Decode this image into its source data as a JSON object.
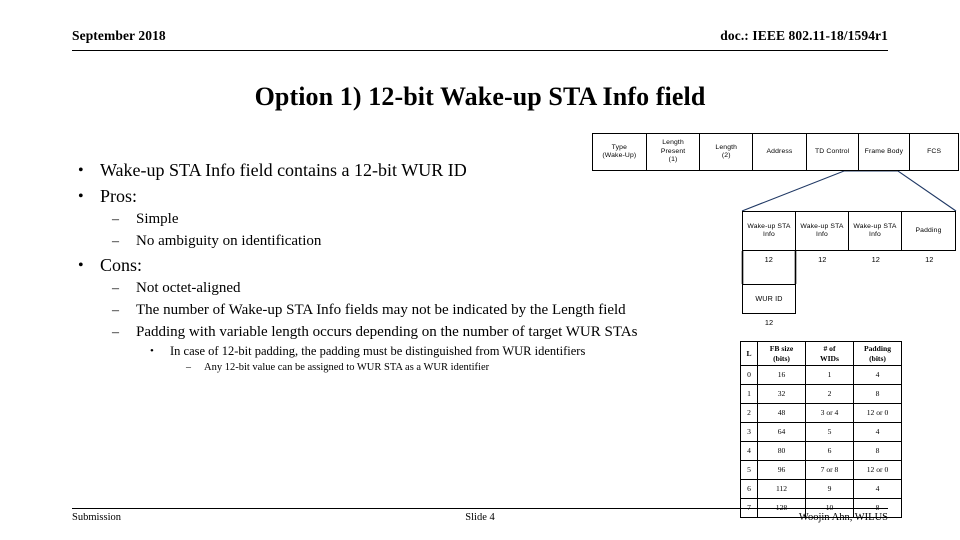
{
  "header": {
    "date": "September 2018",
    "doc": "doc.: IEEE 802.11-18/1594r1"
  },
  "title": "Option 1) 12-bit Wake-up STA Info field",
  "bullets": {
    "b1": "Wake-up STA Info field contains a 12-bit WUR ID",
    "b2": "Pros:",
    "b2a": "Simple",
    "b2b": "No ambiguity on identification",
    "b3": "Cons:",
    "b3a": "Not octet-aligned",
    "b3b": "The number of Wake-up STA Info fields may not be indicated by the Length field",
    "b3c": "Padding with variable length occurs depending on the number of target WUR STAs",
    "b3c1": "In case of 12-bit padding, the padding must be distinguished from WUR identifiers",
    "b3c1a": "Any 12-bit value can be assigned to WUR STA as a WUR identifier"
  },
  "markers": {
    "dot": "•",
    "dash": "–",
    "small_dot": "•",
    "tiny_dash": "–"
  },
  "diagram": {
    "frame_row": [
      {
        "line1": "Type",
        "line2": "(Wake-Up)",
        "line3": ""
      },
      {
        "line1": "Length",
        "line2": "Present",
        "line3": "(1)"
      },
      {
        "line1": "Length",
        "line2": "(2)",
        "line3": ""
      },
      {
        "line1": "Address",
        "line2": "",
        "line3": ""
      },
      {
        "line1": "TD Control",
        "line2": "",
        "line3": ""
      },
      {
        "line1": "Frame Body",
        "line2": "",
        "line3": ""
      },
      {
        "line1": "FCS",
        "line2": "",
        "line3": ""
      }
    ],
    "info_row": [
      {
        "line1": "Wake-up STA",
        "line2": "Info",
        "bits": "12"
      },
      {
        "line1": "Wake-up STA",
        "line2": "Info",
        "bits": "12"
      },
      {
        "line1": "Wake-up STA",
        "line2": "Info",
        "bits": "12"
      },
      {
        "line1": "Padding",
        "line2": "",
        "bits": "12"
      }
    ],
    "wurid": {
      "label": "WUR ID",
      "bits": "12"
    },
    "connector_color": "#1F3864"
  },
  "table": {
    "headers": [
      {
        "line1": "L",
        "line2": ""
      },
      {
        "line1": "FB size",
        "line2": "(bits)"
      },
      {
        "line1": "# of",
        "line2": "WIDs"
      },
      {
        "line1": "Padding",
        "line2": "(bits)"
      }
    ],
    "rows": [
      [
        "0",
        "16",
        "1",
        "4"
      ],
      [
        "1",
        "32",
        "2",
        "8"
      ],
      [
        "2",
        "48",
        "3 or 4",
        "12 or 0"
      ],
      [
        "3",
        "64",
        "5",
        "4"
      ],
      [
        "4",
        "80",
        "6",
        "8"
      ],
      [
        "5",
        "96",
        "7 or 8",
        "12 or 0"
      ],
      [
        "6",
        "112",
        "9",
        "4"
      ],
      [
        "7",
        "128",
        "10",
        "8"
      ]
    ]
  },
  "footer": {
    "left": "Submission",
    "center": "Slide 4",
    "right": "Woojin Ahn, WILUS"
  }
}
